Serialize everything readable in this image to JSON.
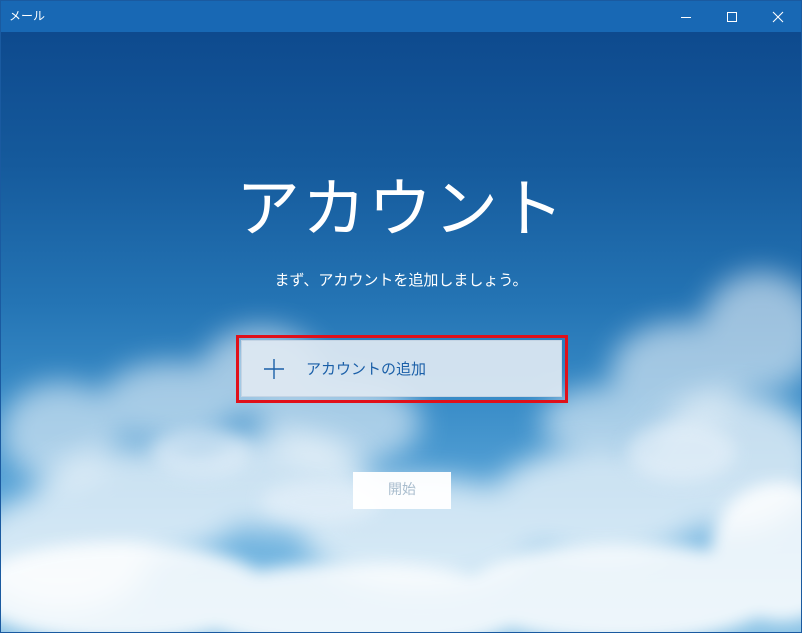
{
  "window": {
    "title": "メール",
    "controls": [
      "minimize",
      "maximize",
      "close"
    ]
  },
  "main": {
    "heading": "アカウント",
    "subtitle": "まず、アカウントを追加しましょう。",
    "add_account": {
      "label": "アカウントの追加",
      "icon": "plus-icon",
      "highlighted": true
    },
    "start_button": {
      "label": "開始",
      "enabled": false
    }
  },
  "colors": {
    "titlebar": "#1868b4",
    "sky_top": "#0e4a8e",
    "sky_bottom": "#8cc4e6",
    "accent_text": "#1a5fa8",
    "highlight_border": "#e0101a",
    "disabled_text": "#a8bccd"
  }
}
